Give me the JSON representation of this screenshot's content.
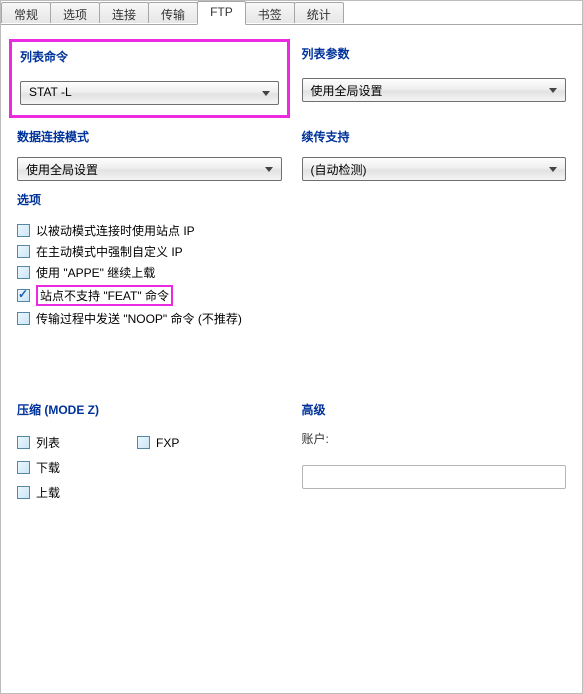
{
  "tabs": [
    "常规",
    "选项",
    "连接",
    "传输",
    "FTP",
    "书签",
    "统计"
  ],
  "activeTab": "FTP",
  "listCommand": {
    "label": "列表命令",
    "value": "STAT -L"
  },
  "listParams": {
    "label": "列表参数",
    "value": "使用全局设置"
  },
  "dataConnMode": {
    "label": "数据连接模式",
    "value": "使用全局设置"
  },
  "resume": {
    "label": "续传支持",
    "value": "(自动检测)"
  },
  "options": {
    "label": "选项",
    "items": [
      {
        "checked": false,
        "label": "以被动模式连接时使用站点 IP"
      },
      {
        "checked": false,
        "label": "在主动模式中强制自定义 IP"
      },
      {
        "checked": false,
        "label": "使用 \"APPE\" 继续上载"
      },
      {
        "checked": true,
        "label": "站点不支持 \"FEAT\" 命令",
        "highlight": true
      },
      {
        "checked": false,
        "label": "传输过程中发送 \"NOOP\" 命令 (不推荐)"
      }
    ]
  },
  "compress": {
    "label": "压缩 (MODE Z)",
    "items": {
      "list": "列表",
      "fxp": "FXP",
      "download": "下载",
      "upload": "上载"
    }
  },
  "advanced": {
    "label": "高级",
    "accountLabel": "账户:",
    "accountValue": ""
  }
}
